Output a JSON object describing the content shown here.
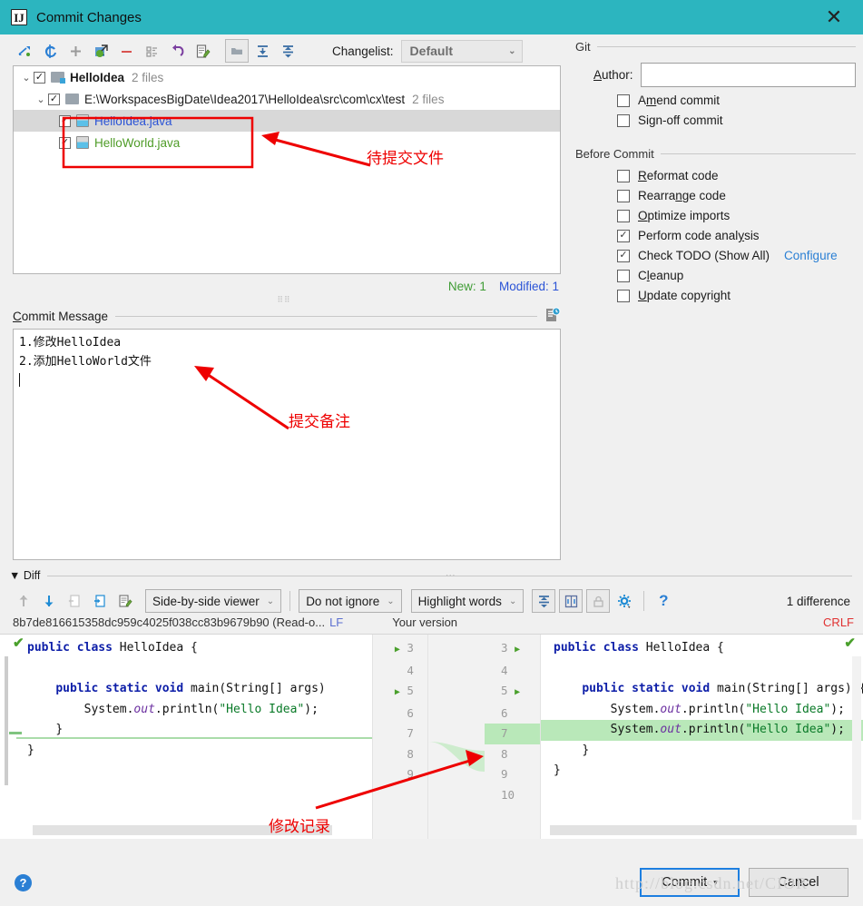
{
  "window": {
    "title": "Commit Changes",
    "logo_glyph": "IJ",
    "close_label": "✕"
  },
  "toolbar": {
    "icons": [
      {
        "name": "show-diff-icon",
        "glyph": "⇥"
      },
      {
        "name": "refresh-icon",
        "glyph": "↻"
      },
      {
        "name": "add-icon",
        "glyph": "+"
      },
      {
        "name": "move-to-changelist-icon",
        "glyph": "▣"
      },
      {
        "name": "delete-icon",
        "glyph": "−"
      },
      {
        "name": "group-by-icon",
        "glyph": "▤"
      },
      {
        "name": "revert-icon",
        "glyph": "↩"
      },
      {
        "name": "edit-source-icon",
        "glyph": "✎"
      },
      {
        "name": "group-by-directory-icon",
        "glyph": "▤"
      },
      {
        "name": "expand-all-icon",
        "glyph": "⤓"
      },
      {
        "name": "collapse-all-icon",
        "glyph": "⤒"
      }
    ],
    "changelist_label": "Changelist:",
    "changelist_value": "Default"
  },
  "tree": {
    "rows": [
      {
        "indent": 0,
        "arrow": "⌄",
        "checked": true,
        "icon": "folder-module",
        "name": "HelloIdea",
        "count": "2 files",
        "selected": false,
        "color": "default"
      },
      {
        "indent": 1,
        "arrow": "⌄",
        "checked": true,
        "icon": "folder",
        "name": "E:\\WorkspacesBigDate\\Idea2017\\HelloIdea\\src\\com\\cx\\test",
        "count": "2 files",
        "selected": false,
        "color": "path"
      },
      {
        "indent": 2,
        "arrow": "",
        "checked": true,
        "icon": "java-file",
        "name": "HelloIdea.java",
        "count": "",
        "selected": true,
        "color": "blue"
      },
      {
        "indent": 2,
        "arrow": "",
        "checked": true,
        "icon": "java-file",
        "name": "HelloWorld.java",
        "count": "",
        "selected": false,
        "color": "green"
      }
    ],
    "status_new": "New: 1",
    "status_modified": "Modified: 1"
  },
  "commit_message": {
    "label": "Commit Message",
    "label_mnemonic": "C",
    "history_icon": "message-history-icon",
    "lines": [
      "1.修改HelloIdea",
      "2.添加HelloWorld文件"
    ]
  },
  "git_panel": {
    "title": "Git",
    "author_label": "Author:",
    "author_mnemonic": "A",
    "author_value": "",
    "checkboxes": [
      {
        "label": "Amend commit",
        "checked": false,
        "mnemonic": "m"
      },
      {
        "label": "Sign-off commit",
        "checked": false,
        "mnemonic": "g"
      }
    ]
  },
  "before_commit": {
    "title": "Before Commit",
    "checkboxes": [
      {
        "label": "Reformat code",
        "checked": false,
        "mnemonic": "R"
      },
      {
        "label": "Rearrange code",
        "checked": false,
        "mnemonic": "n"
      },
      {
        "label": "Optimize imports",
        "checked": false,
        "mnemonic": "O"
      },
      {
        "label": "Perform code analysis",
        "checked": true,
        "mnemonic": "y"
      },
      {
        "label": "Check TODO (Show All)",
        "checked": true,
        "link": "Configure"
      },
      {
        "label": "Cleanup",
        "checked": false,
        "mnemonic": "l"
      },
      {
        "label": "Update copyright",
        "checked": false,
        "mnemonic": "U"
      }
    ]
  },
  "diff": {
    "section_label": "Diff",
    "section_arrow": "▼",
    "toolbar_icons": [
      {
        "name": "previous-difference-icon",
        "glyph": "↑",
        "enabled": false
      },
      {
        "name": "next-difference-icon",
        "glyph": "↓",
        "enabled": true
      },
      {
        "name": "accept-left-icon",
        "glyph": "◁",
        "enabled": false
      },
      {
        "name": "append-right-icon",
        "glyph": "▷",
        "enabled": true
      },
      {
        "name": "edit-source-icon",
        "glyph": "✎",
        "enabled": true
      }
    ],
    "viewer_mode": "Side-by-side viewer",
    "ignore_mode": "Do not ignore",
    "highlight_mode": "Highlight words",
    "collapse_unchanged_icon": "collapse-unchanged-icon",
    "synchronize_scroll_icon": "synchronize-scrolling-icon",
    "readonly_lock_icon": "lock-icon",
    "settings_icon": "gear-icon",
    "help_icon": "question-icon",
    "difference_count": "1 difference",
    "left_revision": "8b7de816615358dc959c4025f038cc83b9679b90 (Read-o...",
    "left_line_sep": "LF",
    "right_title": "Your version",
    "right_line_sep": "CRLF",
    "left_lines": [
      {
        "no": "3",
        "run": true,
        "text": "public class HelloIdea {",
        "state": "normal"
      },
      {
        "no": "4",
        "run": false,
        "text": "",
        "state": "normal"
      },
      {
        "no": "5",
        "run": true,
        "text": "    public static void main(String[] args)",
        "state": "normal"
      },
      {
        "no": "6",
        "run": false,
        "text": "        System.out.println(\"Hello Idea\");",
        "state": "normal"
      },
      {
        "no": "7",
        "run": false,
        "text": "    }",
        "state": "normal"
      },
      {
        "no": "8",
        "run": false,
        "text": "}",
        "state": "normal"
      },
      {
        "no": "9",
        "run": false,
        "text": "",
        "state": "normal"
      }
    ],
    "right_lines": [
      {
        "no": "3",
        "run": true,
        "text": "public class HelloIdea {",
        "state": "normal"
      },
      {
        "no": "4",
        "run": false,
        "text": "",
        "state": "normal"
      },
      {
        "no": "5",
        "run": true,
        "text": "    public static void main(String[] args) {",
        "state": "normal"
      },
      {
        "no": "6",
        "run": false,
        "text": "        System.out.println(\"Hello Idea\");",
        "state": "normal"
      },
      {
        "no": "7",
        "run": false,
        "text": "        System.out.println(\"Hello Idea\");",
        "state": "inserted"
      },
      {
        "no": "8",
        "run": false,
        "text": "    }",
        "state": "normal"
      },
      {
        "no": "9",
        "run": false,
        "text": "}",
        "state": "normal"
      },
      {
        "no": "10",
        "run": false,
        "text": "",
        "state": "normal"
      }
    ]
  },
  "footer": {
    "help_label": "?",
    "commit_label": "Commit",
    "commit_dropdown": "▾",
    "cancel_label": "Cancel",
    "watermark": "http://blog.csdn.net/CIOR"
  },
  "annotations": [
    {
      "name": "annotation-files-to-commit",
      "text": "待提交文件"
    },
    {
      "name": "annotation-commit-remark",
      "text": "提交备注"
    },
    {
      "name": "annotation-change-record",
      "text": "修改记录"
    }
  ],
  "colors": {
    "title_bar": "#2cb5bf",
    "annotation_red": "#ee0000",
    "link_blue": "#2a7fd4",
    "new_green": "#3f9c35",
    "modified_blue": "#2a53d6",
    "inserted_green": "#b9e8b9",
    "crlf_red": "#e03131"
  }
}
